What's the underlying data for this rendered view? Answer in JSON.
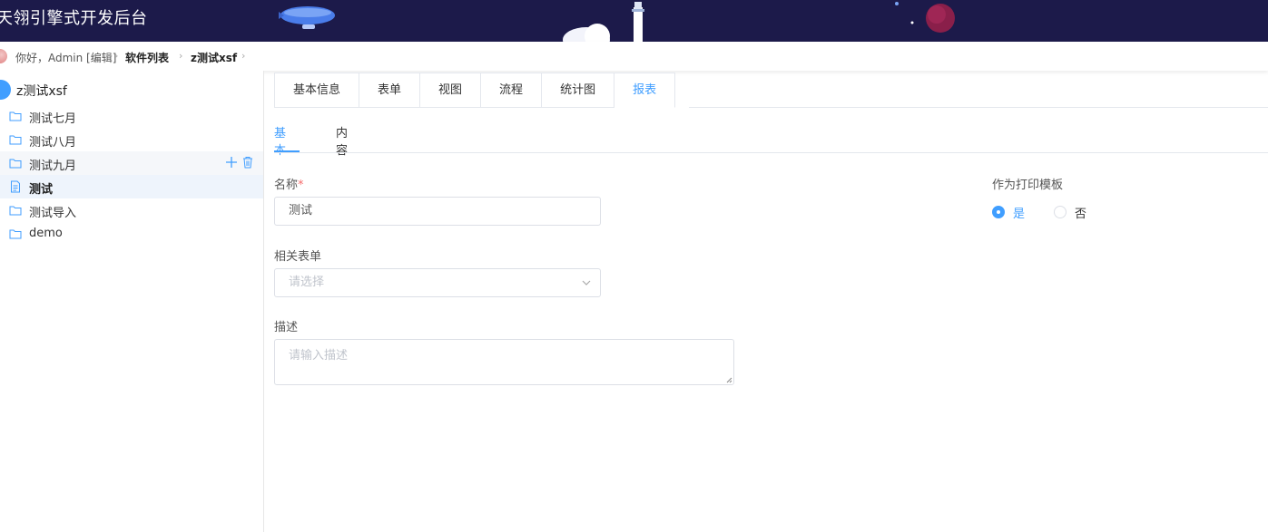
{
  "header": {
    "title": "天翎引擎式开发后台"
  },
  "breadcrumb": {
    "greeting": "你好，Admin [编辑]",
    "items": [
      "软件列表",
      "z测试xsf"
    ],
    "separator": "›"
  },
  "sidebar": {
    "root": {
      "label": "z测试xsf",
      "icon": "home-icon"
    },
    "items": [
      {
        "label": "测试七月",
        "icon": "folder-icon"
      },
      {
        "label": "测试八月",
        "icon": "folder-icon"
      },
      {
        "label": "测试九月",
        "icon": "folder-icon"
      },
      {
        "label": "测试",
        "icon": "document-icon"
      },
      {
        "label": "测试导入",
        "icon": "folder-icon"
      },
      {
        "label": "demo",
        "icon": "folder-icon"
      }
    ],
    "hover_actions": [
      "add-icon",
      "trash-icon"
    ]
  },
  "tabs": [
    "基本信息",
    "表单",
    "视图",
    "流程",
    "统计图",
    "报表"
  ],
  "active_tab": "报表",
  "subtabs": [
    "基本",
    "内容"
  ],
  "active_subtab": "基本",
  "form": {
    "name_label": "名称",
    "required_mark": "*",
    "name_value": "测试",
    "related_form_label": "相关表单",
    "related_form_placeholder": "请选择",
    "description_label": "描述",
    "description_placeholder": "请输入描述",
    "print_template_label": "作为打印模板",
    "print_template_options": [
      "是",
      "否"
    ],
    "print_template_selected": "是"
  },
  "colors": {
    "accent": "#409eff",
    "header_bg": "#1c1a4a"
  }
}
